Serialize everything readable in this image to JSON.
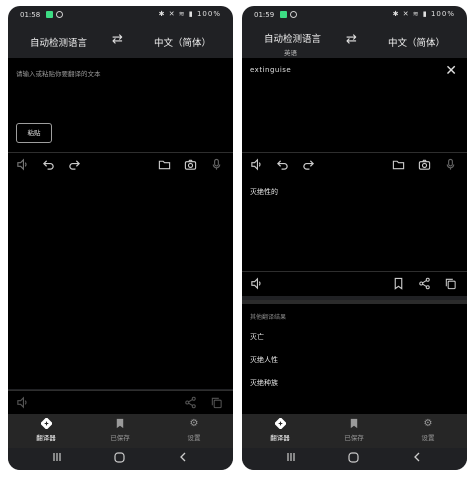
{
  "left": {
    "status": {
      "time": "01:58",
      "icons": "✱ ✕ ≋ ▮ 100%"
    },
    "source_lang": "自动检测语言",
    "target_lang": "中文（简体）",
    "placeholder": "请输入或粘贴你要翻译的文本",
    "paste_label": "粘贴"
  },
  "right": {
    "status": {
      "time": "01:59",
      "icons": "✱ ✕ ≋ ▮ 100%"
    },
    "source_lang": "自动检测语言",
    "detected_lang": "英语",
    "target_lang": "中文（简体）",
    "input_text": "extinguise",
    "translation": "灭绝性的",
    "other_header": "其他翻译结果",
    "other_results": [
      "灭亡",
      "灭绝人性",
      "灭绝种族"
    ]
  },
  "nav": {
    "translate": "翻译器",
    "saved": "已保存",
    "settings": "设置"
  },
  "icons": {
    "speaker": "speaker-icon",
    "undo": "undo-icon",
    "redo": "redo-icon",
    "folder": "folder-icon",
    "camera": "camera-icon",
    "mic": "mic-icon",
    "share": "share-icon",
    "copy": "copy-icon",
    "bookmark": "bookmark-icon",
    "close": "close-icon",
    "swap": "swap-icon",
    "gear": "gear-icon"
  },
  "colors": {
    "background": "#202124",
    "panel": "#000000",
    "nav_bg": "#262626",
    "status_green": "#3ddc84",
    "status_red": "#e04a4a"
  }
}
